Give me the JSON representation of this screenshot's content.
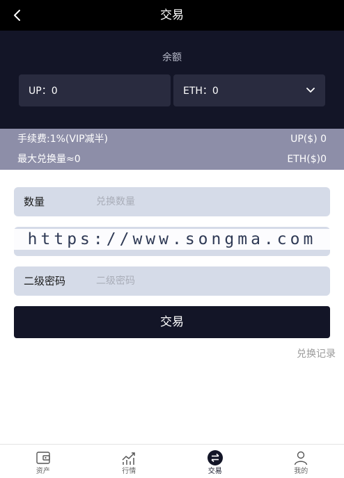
{
  "header": {
    "title": "交易"
  },
  "balance": {
    "title": "余额",
    "up_label": "UP：0",
    "eth_label": "ETH：0"
  },
  "fees": {
    "fee_text": "手续费:1%(VIP减半)",
    "up_price": "UP($) 0",
    "max_exchange": "最大兑换量≈0",
    "eth_price": "ETH($)0"
  },
  "form": {
    "quantity_label": "数量",
    "quantity_placeholder": "兑换数量",
    "password_label": "二级密码",
    "password_placeholder": "二级密码",
    "submit_label": "交易",
    "record_link": "兑换记录"
  },
  "watermark": "https://www.songma.com",
  "nav": {
    "items": [
      {
        "label": "资产",
        "icon": "wallet-icon"
      },
      {
        "label": "行情",
        "icon": "chart-icon"
      },
      {
        "label": "交易",
        "icon": "exchange-icon"
      },
      {
        "label": "我的",
        "icon": "user-icon"
      }
    ],
    "active_index": 2
  },
  "colors": {
    "header_bg": "#000000",
    "panel_bg": "#131527",
    "box_bg": "#292b3f",
    "strip_bg": "#8d8ea8",
    "field_bg": "#d5dbe8",
    "button_bg": "#131527"
  }
}
